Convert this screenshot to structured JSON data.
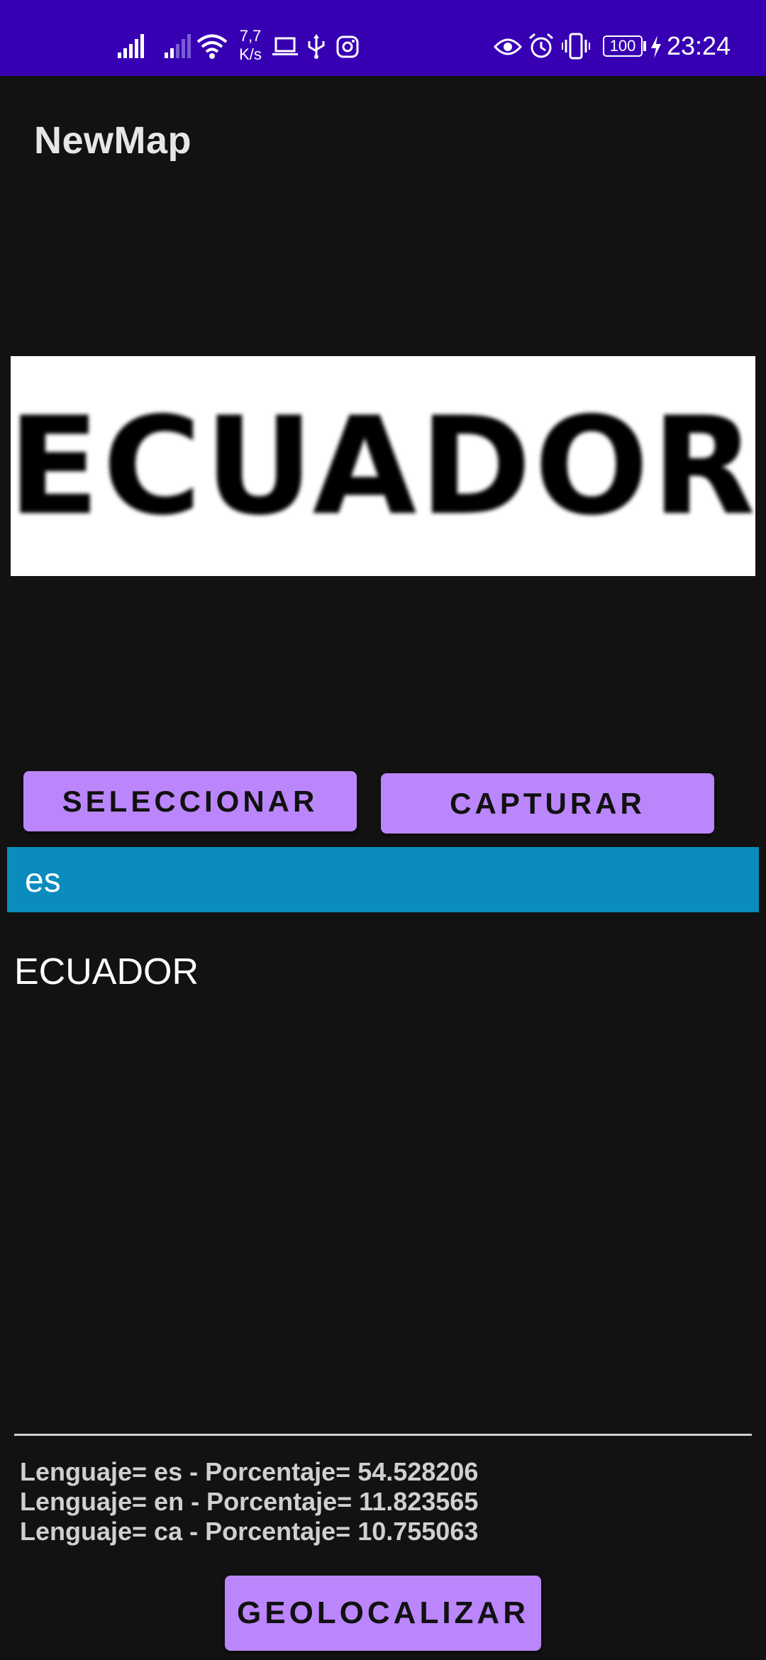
{
  "status_bar": {
    "network_speed_value": "7,7",
    "network_speed_unit": "K/s",
    "battery": "100",
    "time": "23:24",
    "icons": [
      "signal-icon",
      "signal-weak-icon",
      "wifi-icon",
      "laptop-icon",
      "usb-icon",
      "instagram-icon",
      "eye-icon",
      "alarm-icon",
      "vibrate-icon",
      "battery-icon",
      "charging-icon"
    ]
  },
  "app_bar": {
    "title": "NewMap"
  },
  "image_preview": {
    "text": "ECUADOR"
  },
  "buttons": {
    "select_label": "SELECCIONAR",
    "capture_label": "CAPTURAR",
    "geolocate_label": "GEOLOCALIZAR"
  },
  "detected_language": "es",
  "recognized_text": "ECUADOR",
  "language_results": [
    "Lenguaje= es - Porcentaje= 54.528206",
    "Lenguaje= en - Porcentaje= 11.823565",
    "Lenguaje= ca - Porcentaje= 10.755063"
  ],
  "colors": {
    "status_bar": "#3700b3",
    "background": "#121212",
    "button": "#bb86fc",
    "language_bar": "#0a8cbc"
  }
}
